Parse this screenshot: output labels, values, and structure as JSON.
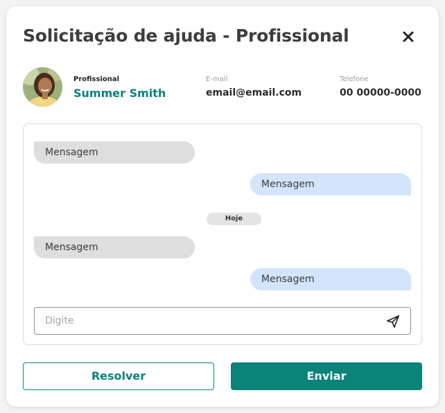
{
  "modal": {
    "title": "Solicitação de ajuda - Profissional",
    "close_icon": "close-icon"
  },
  "contact": {
    "role_label": "Profissional",
    "name": "Summer Smith",
    "email_label": "E-mail",
    "email": "email@email.com",
    "phone_label": "Telefone",
    "phone": "00 00000-0000"
  },
  "chat": {
    "messages": [
      {
        "direction": "in",
        "text": "Mensagem"
      },
      {
        "direction": "out",
        "text": "Mensagem"
      },
      {
        "direction": "in",
        "text": "Mensagem"
      },
      {
        "direction": "out",
        "text": "Mensagem"
      }
    ],
    "date_separator": "Hoje",
    "input_placeholder": "Digite",
    "send_icon": "send-icon"
  },
  "actions": {
    "resolve_label": "Resolver",
    "send_label": "Enviar"
  },
  "colors": {
    "accent": "#0a8379",
    "incoming_bubble": "#dedede",
    "outgoing_bubble": "#d3e4fd"
  }
}
